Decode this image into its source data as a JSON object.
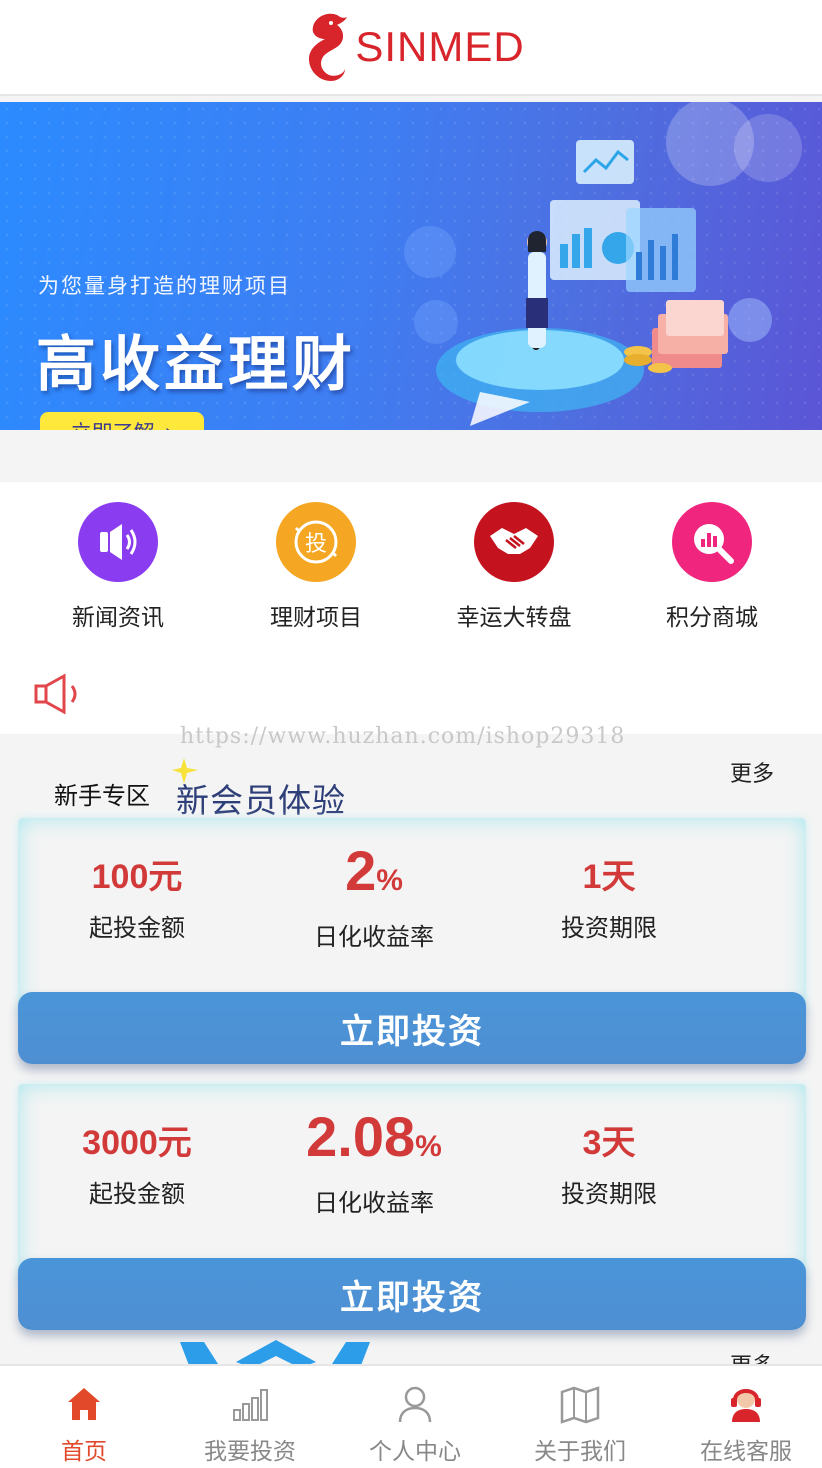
{
  "brand": {
    "name": "SINMED",
    "color": "#d8242b"
  },
  "banner": {
    "subtitle": "为您量身打造的理财项目",
    "title": "高收益理财",
    "button_label": "立即了解",
    "button_arrow": "›"
  },
  "quick_nav": [
    {
      "label": "新闻资讯",
      "icon": "speaker-icon",
      "color": "#8a3cf0"
    },
    {
      "label": "理财项目",
      "icon": "invest-icon",
      "glyph": "投",
      "color": "#f5a623"
    },
    {
      "label": "幸运大转盘",
      "icon": "handshake-icon",
      "color": "#c4121f"
    },
    {
      "label": "积分商城",
      "icon": "chart-search-icon",
      "color": "#f0257e"
    }
  ],
  "watermark": "https://www.huzhan.com/ishop29318",
  "newbie_section": {
    "title": "新手专区",
    "badge": "新会员体验",
    "more": "更多"
  },
  "products": [
    {
      "min_amount": "100元",
      "min_amount_label": "起投金额",
      "rate_value": "2",
      "rate_unit": "%",
      "rate_label": "日化收益率",
      "term": "1天",
      "term_label": "投资期限",
      "button_label": "立即投资"
    },
    {
      "min_amount": "3000元",
      "min_amount_label": "起投金额",
      "rate_value": "2.08",
      "rate_unit": "%",
      "rate_label": "日化收益率",
      "term": "3天",
      "term_label": "投资期限",
      "button_label": "立即投资"
    }
  ],
  "next_section": {
    "more": "更多"
  },
  "tabbar": [
    {
      "label": "首页",
      "icon": "home-icon",
      "active": true
    },
    {
      "label": "我要投资",
      "icon": "bar-chart-icon",
      "active": false
    },
    {
      "label": "个人中心",
      "icon": "user-icon",
      "active": false
    },
    {
      "label": "关于我们",
      "icon": "map-book-icon",
      "active": false
    },
    {
      "label": "在线客服",
      "icon": "customer-service-icon",
      "active": false
    }
  ],
  "colors": {
    "accent_red": "#d23a3a",
    "tab_active": "#e2492b",
    "invest_button": "#4a95d8"
  }
}
